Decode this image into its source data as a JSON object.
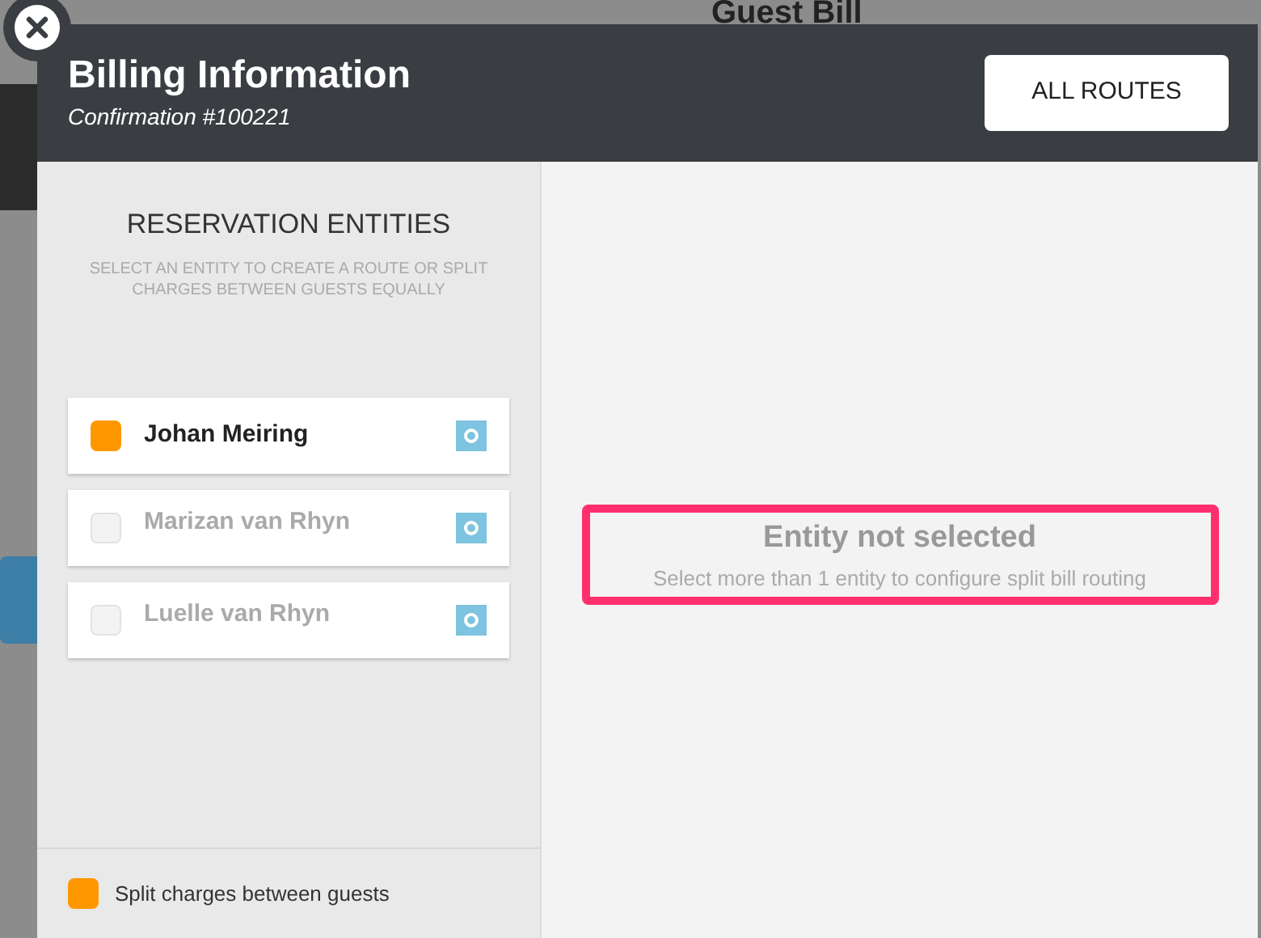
{
  "background": {
    "title": "Guest Bill"
  },
  "modal": {
    "title": "Billing Information",
    "subtitle": "Confirmation #100221",
    "button": "ALL ROUTES"
  },
  "entities_panel": {
    "heading": "RESERVATION ENTITIES",
    "hint": "SELECT AN ENTITY TO CREATE A ROUTE OR SPLIT CHARGES BETWEEN GUESTS EQUALLY",
    "entities": [
      {
        "name": "Johan Meiring",
        "selected": true
      },
      {
        "name": "Marizan van Rhyn",
        "selected": false
      },
      {
        "name": "Luelle van Rhyn",
        "selected": false
      }
    ],
    "split": {
      "label": "Split charges between guests",
      "checked": true
    }
  },
  "empty_state": {
    "title": "Entity not selected",
    "message": "Select more than 1 entity to configure split bill routing"
  }
}
